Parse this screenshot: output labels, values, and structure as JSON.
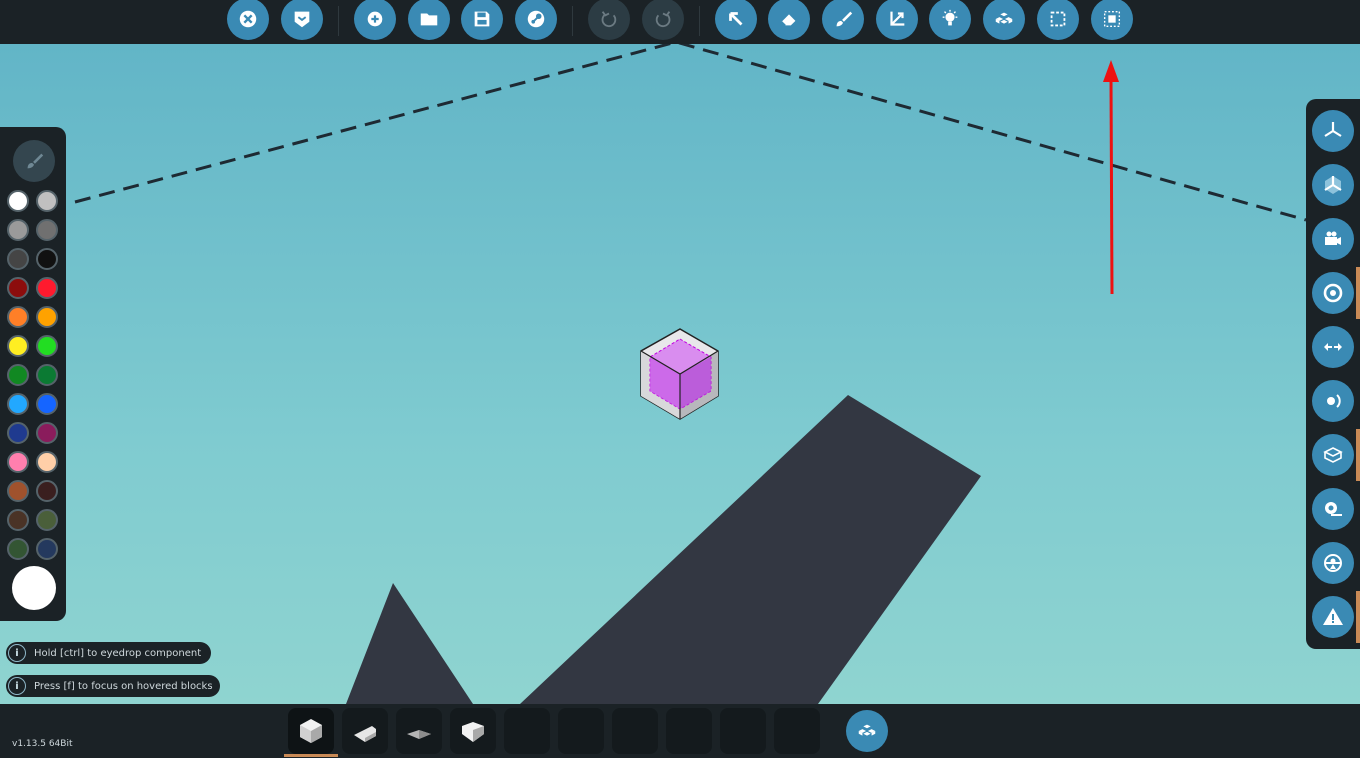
{
  "colors": {
    "accent": "#3a8ab4",
    "panel": "#1b2226",
    "sky_top": "#62b5c7",
    "sky_bottom": "#8fd4d0",
    "terrain": "#333742",
    "arrow": "#ee1111",
    "selected_tab": "#c98a56"
  },
  "toolbar": {
    "items": [
      {
        "icon": "close-icon",
        "state": "enabled"
      },
      {
        "icon": "dropdown-menu-icon",
        "state": "enabled"
      },
      {
        "icon": "new-icon",
        "state": "enabled"
      },
      {
        "icon": "open-folder-icon",
        "state": "enabled"
      },
      {
        "icon": "save-icon",
        "state": "enabled"
      },
      {
        "icon": "steam-icon",
        "state": "enabled"
      },
      {
        "icon": "undo-icon",
        "state": "disabled"
      },
      {
        "icon": "redo-icon",
        "state": "disabled"
      },
      {
        "icon": "select-arrow-icon",
        "state": "enabled"
      },
      {
        "icon": "eraser-icon",
        "state": "enabled"
      },
      {
        "icon": "paint-brush-icon",
        "state": "enabled"
      },
      {
        "icon": "transform-axes-icon",
        "state": "enabled"
      },
      {
        "icon": "light-bulb-icon",
        "state": "enabled"
      },
      {
        "icon": "blocks-icon",
        "state": "enabled"
      },
      {
        "icon": "selection-box-icon",
        "state": "enabled"
      },
      {
        "icon": "select-all-icon",
        "state": "enabled"
      }
    ]
  },
  "palette": {
    "brush_icon": "paint-brush-icon",
    "colors": [
      "#ffffff",
      "#c0c0c0",
      "#9a9a9a",
      "#707070",
      "#454545",
      "#111111",
      "#8c0d0d",
      "#ff1a2e",
      "#ff7f27",
      "#ffa200",
      "#ffee22",
      "#22dd22",
      "#118822",
      "#0b7a33",
      "#22a8ff",
      "#1565ff",
      "#1f3a8f",
      "#8a1c5c",
      "#ff7fae",
      "#ffcfa8",
      "#a0522d",
      "#3a1f1f",
      "#4a3326",
      "#4a5f3a",
      "#335533",
      "#24395e"
    ],
    "active_color": "#ffffff"
  },
  "right_panel": {
    "items": [
      {
        "icon": "axis-view-icon"
      },
      {
        "icon": "axis-view-alt-icon"
      },
      {
        "icon": "camera-icon"
      },
      {
        "icon": "target-icon"
      },
      {
        "icon": "move-arrows-icon"
      },
      {
        "icon": "orbit-icon"
      },
      {
        "icon": "cube-outline-icon"
      },
      {
        "icon": "tape-measure-icon"
      },
      {
        "icon": "inspect-icon"
      },
      {
        "icon": "warning-icon"
      }
    ]
  },
  "hints": [
    {
      "text": "Hold [ctrl] to eyedrop component"
    },
    {
      "text": "Press [f] to focus on hovered blocks"
    }
  ],
  "bottom_bar": {
    "slots": [
      {
        "icon": "cube-block-icon",
        "selected": true
      },
      {
        "icon": "wedge-block-icon",
        "selected": false
      },
      {
        "icon": "pyramid-block-icon",
        "selected": false
      },
      {
        "icon": "half-cube-block-icon",
        "selected": false
      },
      {
        "icon": "empty-slot",
        "selected": false
      },
      {
        "icon": "empty-slot",
        "selected": false
      },
      {
        "icon": "empty-slot",
        "selected": false
      },
      {
        "icon": "empty-slot",
        "selected": false
      },
      {
        "icon": "empty-slot",
        "selected": false
      },
      {
        "icon": "empty-slot",
        "selected": false
      }
    ],
    "blocks_button_icon": "blocks-icon"
  },
  "version": "v1.13.5 64Bit"
}
